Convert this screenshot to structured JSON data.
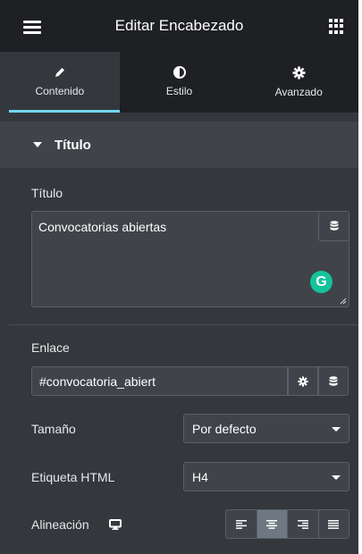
{
  "header": {
    "title": "Editar Encabezado"
  },
  "tabs": [
    {
      "label": "Contenido",
      "icon": "pencil-icon",
      "active": true
    },
    {
      "label": "Estilo",
      "icon": "half-circle-icon",
      "active": false
    },
    {
      "label": "Avanzado",
      "icon": "gear-icon",
      "active": false
    }
  ],
  "section": {
    "title": "Título",
    "expanded": true
  },
  "fields": {
    "titulo": {
      "label": "Título",
      "value": "Convocatorias abiertas"
    },
    "enlace": {
      "label": "Enlace",
      "value": "#convocatoria_abiert"
    },
    "tamano": {
      "label": "Tamaño",
      "value": "Por defecto"
    },
    "etiqueta": {
      "label": "Etiqueta HTML",
      "value": "H4"
    },
    "alineacion": {
      "label": "Alineación",
      "options": [
        "left",
        "center",
        "right",
        "justify"
      ],
      "selected": "center"
    }
  },
  "colors": {
    "panel": "#34383c",
    "header": "#1e2024",
    "accent": "#71d7f7",
    "grammarly": "#15c39a"
  },
  "grammarly_letter": "G"
}
